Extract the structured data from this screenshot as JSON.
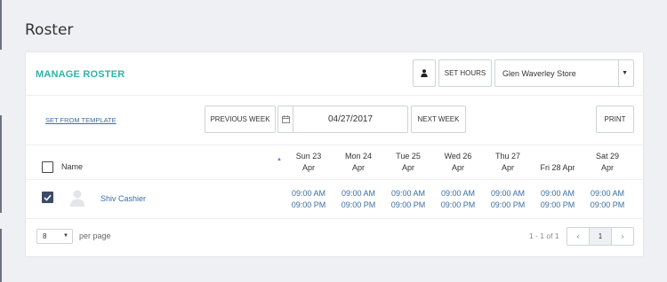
{
  "page": {
    "title": "Roster"
  },
  "manage": {
    "title": "MANAGE ROSTER",
    "set_hours": "SET HOURS",
    "store": "Glen Waverley Store"
  },
  "toolbar": {
    "template_link": "SET FROM TEMPLATE",
    "prev_week": "PREVIOUS WEEK",
    "date": "04/27/2017",
    "next_week": "NEXT WEEK",
    "print": "PRINT"
  },
  "table": {
    "name_header": "Name",
    "days": [
      {
        "l1": "Sun 23",
        "l2": "Apr"
      },
      {
        "l1": "Mon 24",
        "l2": "Apr"
      },
      {
        "l1": "Tue 25",
        "l2": "Apr"
      },
      {
        "l1": "Wed 26",
        "l2": "Apr"
      },
      {
        "l1": "Thu 27",
        "l2": "Apr"
      },
      {
        "l1": "Fri 28 Apr",
        "l2": ""
      },
      {
        "l1": "Sat 29",
        "l2": "Apr"
      }
    ],
    "rows": [
      {
        "name": "Shiv Cashier",
        "checked": true,
        "shifts": [
          {
            "start": "09:00 AM",
            "end": "09:00 PM"
          },
          {
            "start": "09:00 AM",
            "end": "09:00 PM"
          },
          {
            "start": "09:00 AM",
            "end": "09:00 PM"
          },
          {
            "start": "09:00 AM",
            "end": "09:00 PM"
          },
          {
            "start": "09:00 AM",
            "end": "09:00 PM"
          },
          {
            "start": "09:00 AM",
            "end": "09:00 PM"
          },
          {
            "start": "09:00 AM",
            "end": "09:00 PM"
          }
        ]
      }
    ]
  },
  "footer": {
    "per_page_value": "8",
    "per_page_label": "per page",
    "range": "1 - 1 of 1",
    "current_page": "1",
    "prev": "‹",
    "next": "›"
  },
  "colors": {
    "accent": "#2fb3a6",
    "link": "#3a6ea5",
    "checkbox": "#3b4a66"
  }
}
